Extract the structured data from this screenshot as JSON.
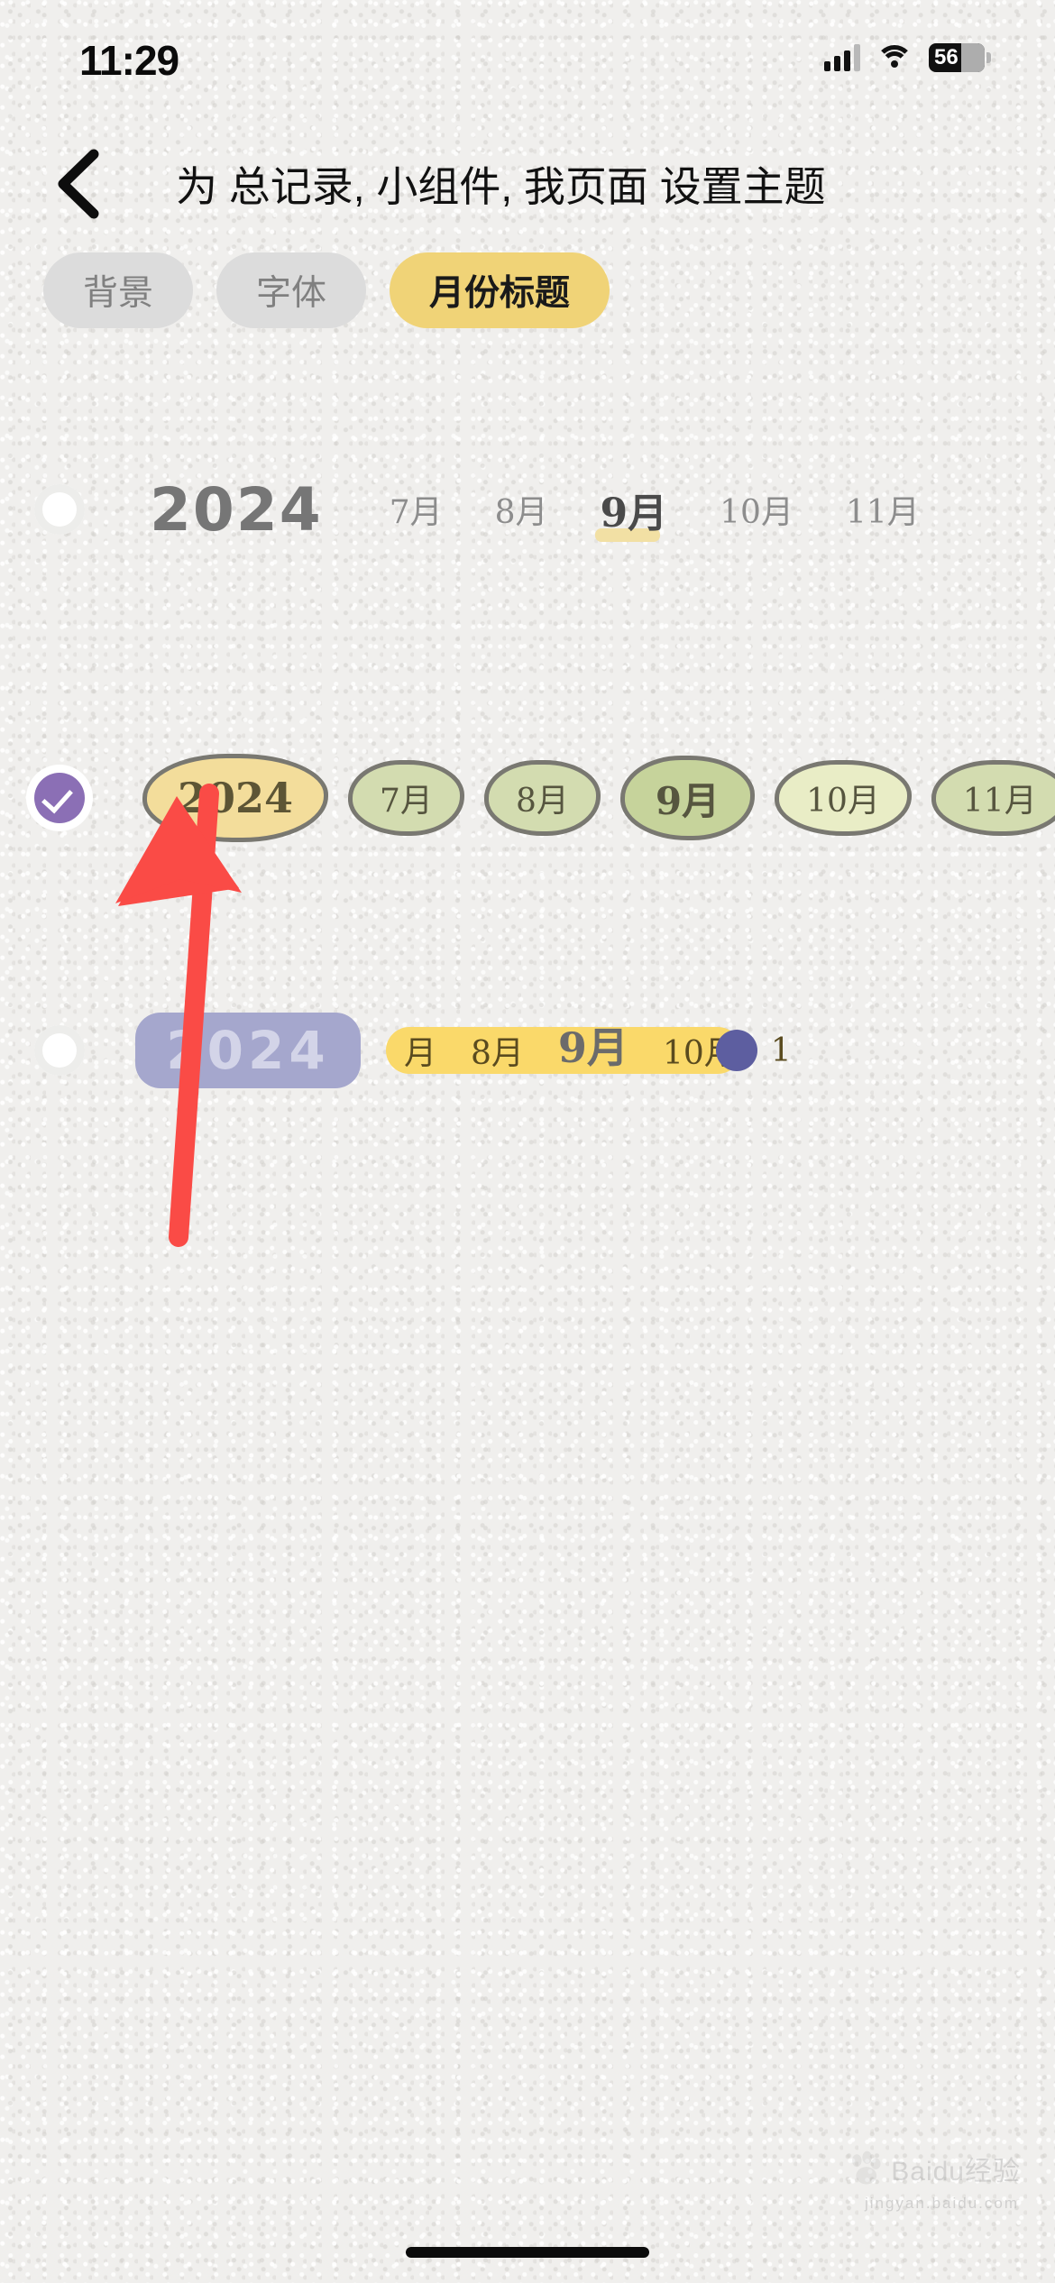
{
  "status_bar": {
    "time": "11:29",
    "battery_level": "56",
    "icons": [
      "signal-bars-icon",
      "wifi-icon",
      "battery-icon"
    ]
  },
  "nav": {
    "back_icon": "chevron-left-icon",
    "title": "为 总记录, 小组件, 我页面 设置主题"
  },
  "tabs": [
    {
      "label": "背景",
      "active": false
    },
    {
      "label": "字体",
      "active": false
    },
    {
      "label": "月份标题",
      "active": true
    }
  ],
  "theme_options": [
    {
      "id": "theme-plain",
      "selected": false,
      "year": "2024",
      "months": [
        "7月",
        "8月",
        "9月",
        "10月",
        "11月"
      ],
      "current_month": "9月"
    },
    {
      "id": "theme-bubble",
      "selected": true,
      "year": "2024",
      "months": [
        "7月",
        "8月",
        "9月",
        "10月",
        "11月"
      ],
      "current_month": "9月"
    },
    {
      "id": "theme-marker",
      "selected": false,
      "year": "2024",
      "months": [
        "月",
        "8月",
        "9月",
        "10月",
        "1"
      ],
      "current_month": "9月"
    }
  ],
  "annotation": {
    "type": "red-arrow",
    "points_to": "2024 year bubble in selected theme row",
    "color": "#fa4b46"
  },
  "watermark": {
    "text": "Baidu经验",
    "subtext": "jingyan.baidu.com"
  },
  "colors": {
    "accent_yellow": "#f0d377",
    "pill_gray": "#dcdcdc",
    "radio_checked_purple": "#8b6fb5",
    "bubble_green": "#d3dcb0",
    "bubble_green_current": "#c6d39b",
    "bubble_green_light": "#e9edc6",
    "bubble_year_yellow": "#f3dd9b",
    "tag_purple": "#a5a7cd",
    "marker_yellow": "#fad96a",
    "dot_navy": "#5d5ea0",
    "page_bg": "#f0efed"
  }
}
